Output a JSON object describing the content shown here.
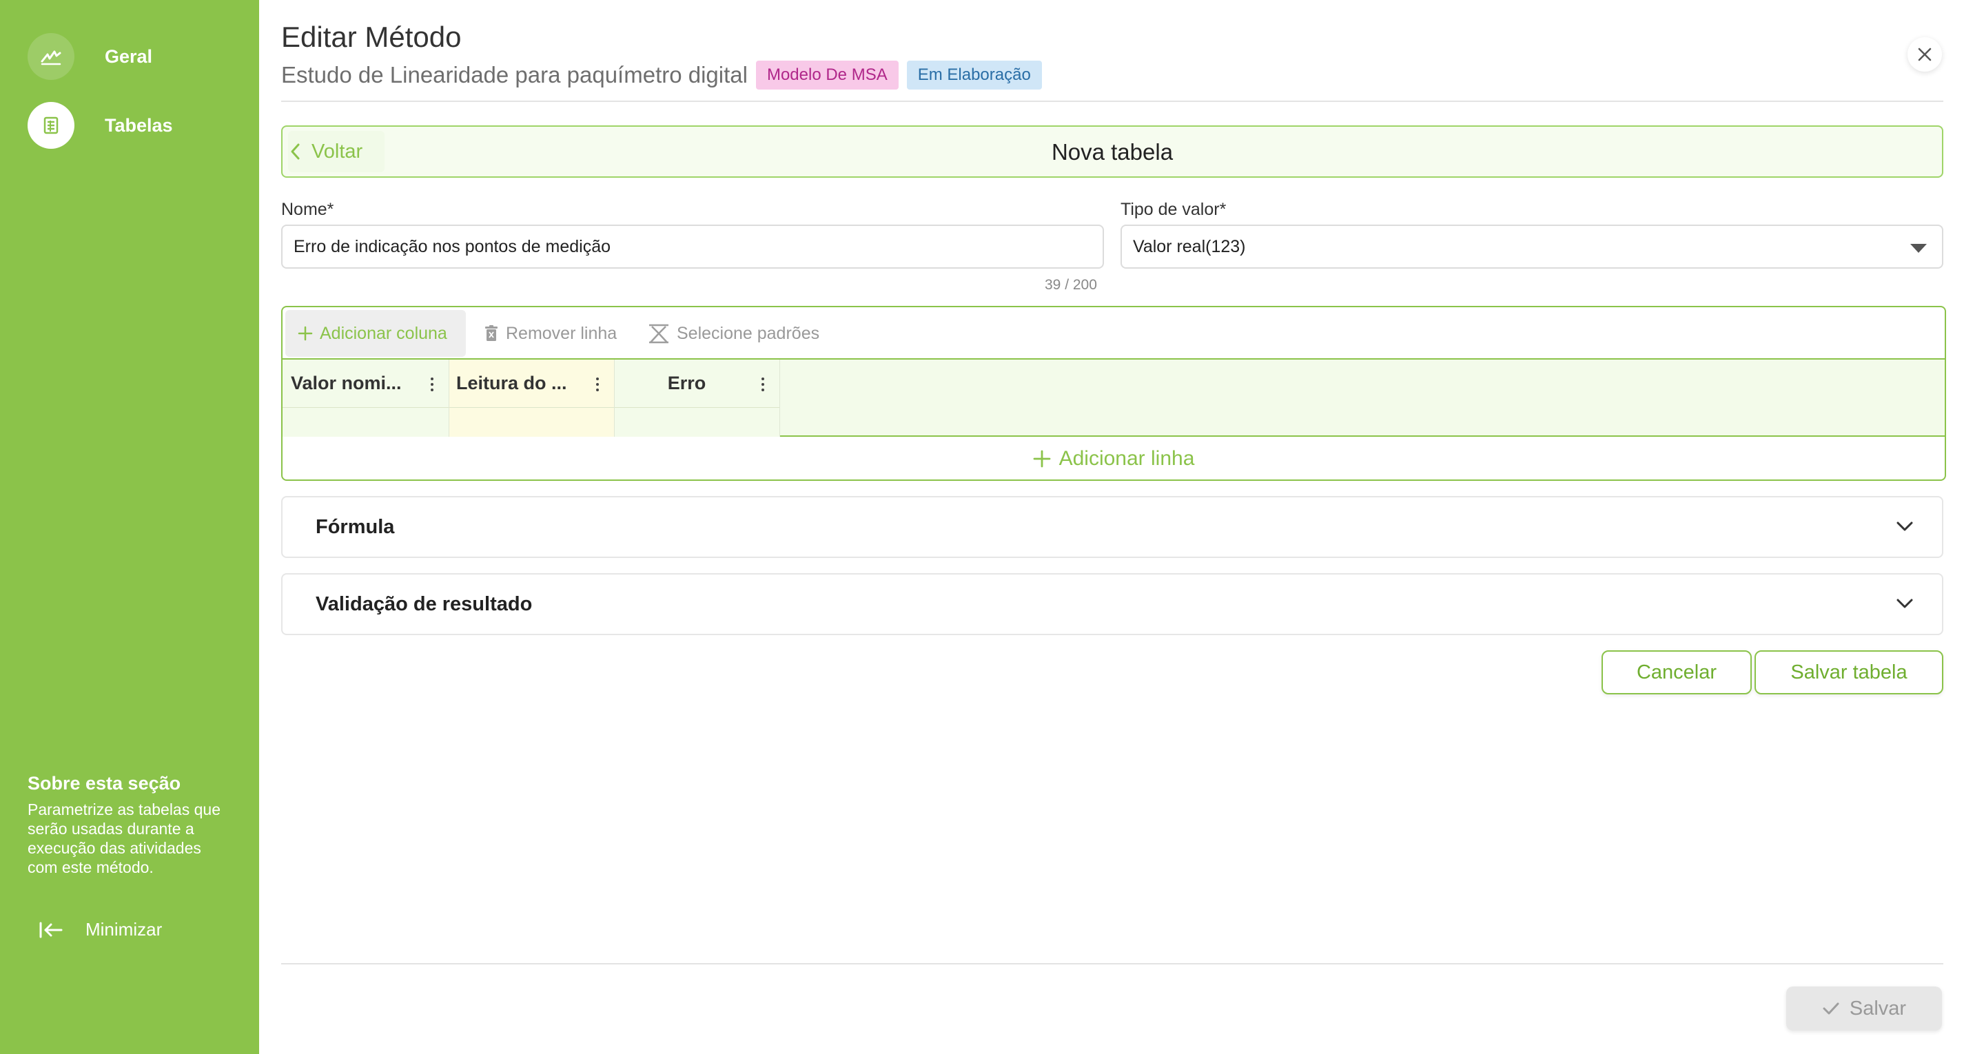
{
  "sidebar": {
    "items": [
      {
        "label": "Geral",
        "icon": "signature-icon",
        "active": false
      },
      {
        "label": "Tabelas",
        "icon": "table-icon",
        "active": true
      }
    ],
    "about_title": "Sobre esta seção",
    "about_text": "Parametrize as tabelas que serão usadas durante a execução das atividades com este método.",
    "minimize_label": "Minimizar"
  },
  "header": {
    "title": "Editar Método",
    "subtitle": "Estudo de Linearidade para paquímetro digital",
    "badges": [
      {
        "label": "Modelo De MSA",
        "bg": "#f8c9e8",
        "color": "#b0278a"
      },
      {
        "label": "Em Elaboração",
        "bg": "#d0e6f7",
        "color": "#2a6ea6"
      }
    ]
  },
  "back_bar": {
    "back_label": "Voltar",
    "title": "Nova tabela"
  },
  "form": {
    "name_label": "Nome*",
    "name_value": "Erro de indicação nos pontos de medição",
    "name_counter": "39 / 200",
    "type_label": "Tipo de valor*",
    "type_value": "Valor real(123)"
  },
  "table_editor": {
    "toolbar": {
      "add_column": "Adicionar coluna",
      "remove_row": "Remover linha",
      "select_patterns": "Selecione padrões"
    },
    "columns": [
      {
        "title": "Valor nomi...",
        "bg": "#f3fbea"
      },
      {
        "title": "Leitura do ...",
        "bg": "#fdfbe1"
      },
      {
        "title": "Erro",
        "bg": "#f3fbea"
      }
    ],
    "add_row": "Adicionar linha"
  },
  "sections": [
    {
      "title": "Fórmula"
    },
    {
      "title": "Validação de resultado"
    }
  ],
  "actions": {
    "cancel": "Cancelar",
    "save_table": "Salvar tabela",
    "save": "Salvar"
  },
  "colors": {
    "accent": "#8bc34a",
    "sidebar": "#8bc34a"
  }
}
